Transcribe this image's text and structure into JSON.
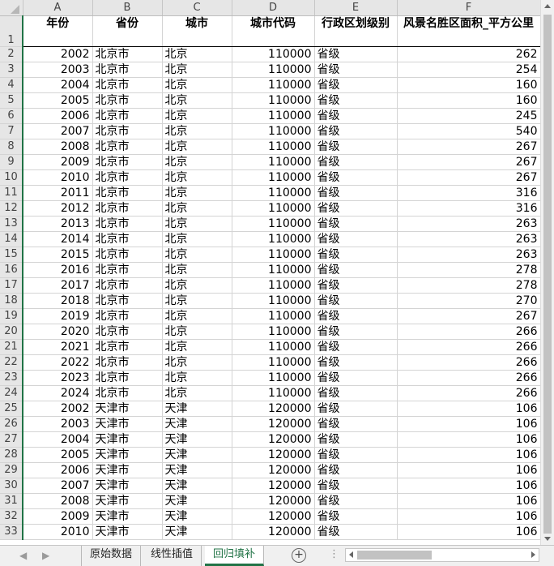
{
  "columns": [
    "A",
    "B",
    "C",
    "D",
    "E",
    "F"
  ],
  "header": {
    "row_num": "1",
    "cells": [
      "年份",
      "省份",
      "城市",
      "城市代码",
      "行政区划级别",
      "风景名胜区面积_平方公里"
    ]
  },
  "rows": [
    {
      "n": "2",
      "year": "2002",
      "prov": "北京市",
      "city": "北京",
      "code": "110000",
      "level": "省级",
      "area": "262"
    },
    {
      "n": "3",
      "year": "2003",
      "prov": "北京市",
      "city": "北京",
      "code": "110000",
      "level": "省级",
      "area": "254"
    },
    {
      "n": "4",
      "year": "2004",
      "prov": "北京市",
      "city": "北京",
      "code": "110000",
      "level": "省级",
      "area": "160"
    },
    {
      "n": "5",
      "year": "2005",
      "prov": "北京市",
      "city": "北京",
      "code": "110000",
      "level": "省级",
      "area": "160"
    },
    {
      "n": "6",
      "year": "2006",
      "prov": "北京市",
      "city": "北京",
      "code": "110000",
      "level": "省级",
      "area": "245"
    },
    {
      "n": "7",
      "year": "2007",
      "prov": "北京市",
      "city": "北京",
      "code": "110000",
      "level": "省级",
      "area": "540"
    },
    {
      "n": "8",
      "year": "2008",
      "prov": "北京市",
      "city": "北京",
      "code": "110000",
      "level": "省级",
      "area": "267"
    },
    {
      "n": "9",
      "year": "2009",
      "prov": "北京市",
      "city": "北京",
      "code": "110000",
      "level": "省级",
      "area": "267"
    },
    {
      "n": "10",
      "year": "2010",
      "prov": "北京市",
      "city": "北京",
      "code": "110000",
      "level": "省级",
      "area": "267"
    },
    {
      "n": "11",
      "year": "2011",
      "prov": "北京市",
      "city": "北京",
      "code": "110000",
      "level": "省级",
      "area": "316"
    },
    {
      "n": "12",
      "year": "2012",
      "prov": "北京市",
      "city": "北京",
      "code": "110000",
      "level": "省级",
      "area": "316"
    },
    {
      "n": "13",
      "year": "2013",
      "prov": "北京市",
      "city": "北京",
      "code": "110000",
      "level": "省级",
      "area": "263"
    },
    {
      "n": "14",
      "year": "2014",
      "prov": "北京市",
      "city": "北京",
      "code": "110000",
      "level": "省级",
      "area": "263"
    },
    {
      "n": "15",
      "year": "2015",
      "prov": "北京市",
      "city": "北京",
      "code": "110000",
      "level": "省级",
      "area": "263"
    },
    {
      "n": "16",
      "year": "2016",
      "prov": "北京市",
      "city": "北京",
      "code": "110000",
      "level": "省级",
      "area": "278"
    },
    {
      "n": "17",
      "year": "2017",
      "prov": "北京市",
      "city": "北京",
      "code": "110000",
      "level": "省级",
      "area": "278"
    },
    {
      "n": "18",
      "year": "2018",
      "prov": "北京市",
      "city": "北京",
      "code": "110000",
      "level": "省级",
      "area": "270"
    },
    {
      "n": "19",
      "year": "2019",
      "prov": "北京市",
      "city": "北京",
      "code": "110000",
      "level": "省级",
      "area": "267"
    },
    {
      "n": "20",
      "year": "2020",
      "prov": "北京市",
      "city": "北京",
      "code": "110000",
      "level": "省级",
      "area": "266"
    },
    {
      "n": "21",
      "year": "2021",
      "prov": "北京市",
      "city": "北京",
      "code": "110000",
      "level": "省级",
      "area": "266"
    },
    {
      "n": "22",
      "year": "2022",
      "prov": "北京市",
      "city": "北京",
      "code": "110000",
      "level": "省级",
      "area": "266"
    },
    {
      "n": "23",
      "year": "2023",
      "prov": "北京市",
      "city": "北京",
      "code": "110000",
      "level": "省级",
      "area": "266"
    },
    {
      "n": "24",
      "year": "2024",
      "prov": "北京市",
      "city": "北京",
      "code": "110000",
      "level": "省级",
      "area": "266"
    },
    {
      "n": "25",
      "year": "2002",
      "prov": "天津市",
      "city": "天津",
      "code": "120000",
      "level": "省级",
      "area": "106"
    },
    {
      "n": "26",
      "year": "2003",
      "prov": "天津市",
      "city": "天津",
      "code": "120000",
      "level": "省级",
      "area": "106"
    },
    {
      "n": "27",
      "year": "2004",
      "prov": "天津市",
      "city": "天津",
      "code": "120000",
      "level": "省级",
      "area": "106"
    },
    {
      "n": "28",
      "year": "2005",
      "prov": "天津市",
      "city": "天津",
      "code": "120000",
      "level": "省级",
      "area": "106"
    },
    {
      "n": "29",
      "year": "2006",
      "prov": "天津市",
      "city": "天津",
      "code": "120000",
      "level": "省级",
      "area": "106"
    },
    {
      "n": "30",
      "year": "2007",
      "prov": "天津市",
      "city": "天津",
      "code": "120000",
      "level": "省级",
      "area": "106"
    },
    {
      "n": "31",
      "year": "2008",
      "prov": "天津市",
      "city": "天津",
      "code": "120000",
      "level": "省级",
      "area": "106"
    },
    {
      "n": "32",
      "year": "2009",
      "prov": "天津市",
      "city": "天津",
      "code": "120000",
      "level": "省级",
      "area": "106"
    },
    {
      "n": "33",
      "year": "2010",
      "prov": "天津市",
      "city": "天津",
      "code": "120000",
      "level": "省级",
      "area": "106"
    }
  ],
  "tabs": [
    {
      "label": "原始数据",
      "active": false
    },
    {
      "label": "线性插值",
      "active": false
    },
    {
      "label": "回归填补",
      "active": true
    }
  ],
  "add_sheet_icon": "plus-circle-icon",
  "accent_color": "#217346"
}
